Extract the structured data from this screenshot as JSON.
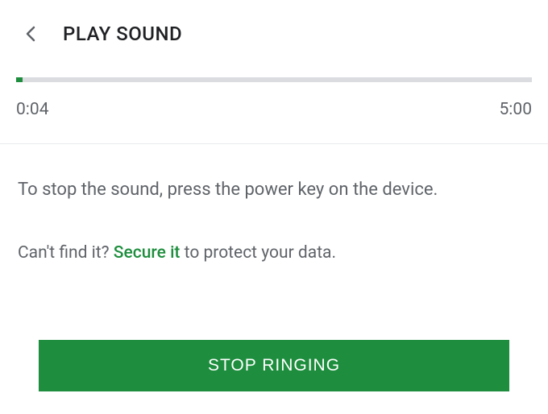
{
  "header": {
    "title": "PLAY SOUND"
  },
  "progress": {
    "elapsed": "0:04",
    "total": "5:00",
    "percent": 1.3
  },
  "content": {
    "instruction": "To stop the sound, press the power key on the device.",
    "cantFindPrefix": "Can't find it? ",
    "secureLink": "Secure it ",
    "cantFindSuffix": "to protect your data."
  },
  "button": {
    "stopRinging": "STOP RINGING"
  }
}
